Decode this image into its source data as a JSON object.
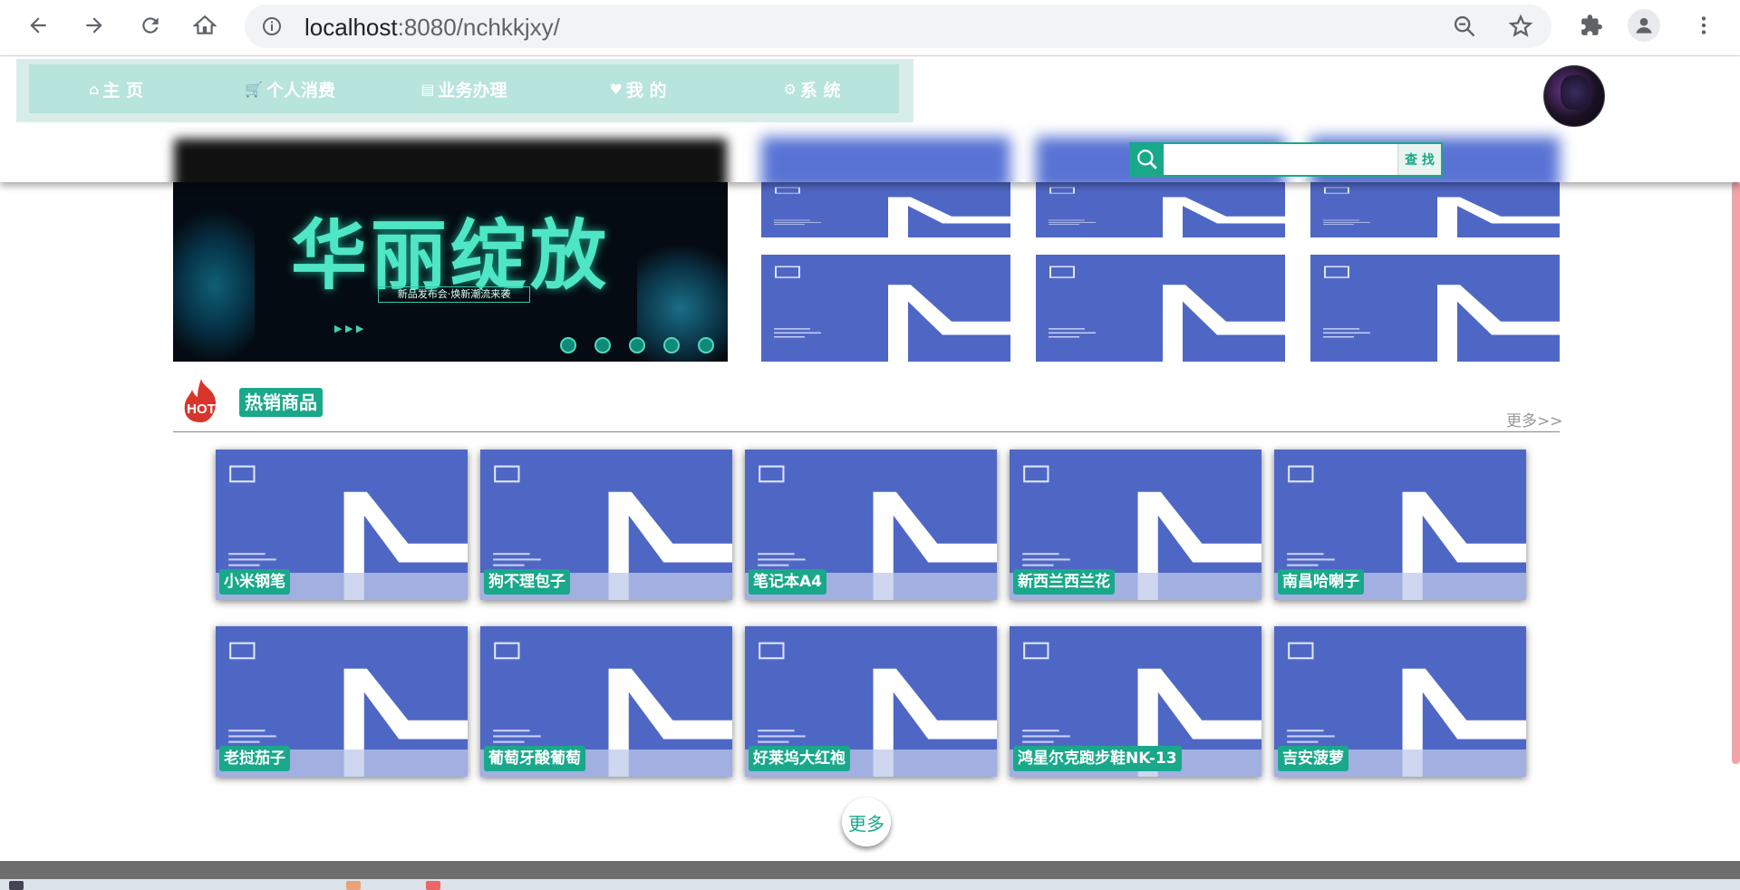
{
  "browser": {
    "url_host": "localhost",
    "url_rest": ":8080/nchkkjxy/"
  },
  "nav": {
    "items": [
      {
        "icon": "⌂",
        "label": "主 页"
      },
      {
        "icon": "🛒",
        "label": "个人消费"
      },
      {
        "icon": "▤",
        "label": "业务办理"
      },
      {
        "icon": "♥",
        "label": "我 的"
      },
      {
        "icon": "⚙",
        "label": "系 统"
      }
    ]
  },
  "search": {
    "placeholder": "",
    "button_label": "查 找"
  },
  "banner": {
    "title": "华丽绽放",
    "subtitle": "新品发布会·焕新潮流来袭",
    "dot_count": 5
  },
  "hot": {
    "icon_text": "HOT",
    "label": "热销商品",
    "more_link": "更多>>"
  },
  "products": [
    {
      "name": "小米钢笔"
    },
    {
      "name": "狗不理包子"
    },
    {
      "name": "笔记本A4"
    },
    {
      "name": "新西兰西兰花"
    },
    {
      "name": "南昌哈喇子"
    },
    {
      "name": "老挝茄子"
    },
    {
      "name": "葡萄牙酸葡萄"
    },
    {
      "name": "好莱坞大红袍"
    },
    {
      "name": "鸿星尔克跑步鞋NK-13"
    },
    {
      "name": "吉安菠萝"
    }
  ],
  "more_button": "更多",
  "colors": {
    "accent": "#19a889",
    "nav_bg": "#b7e4dc",
    "product_blue": "#4f67c4"
  }
}
